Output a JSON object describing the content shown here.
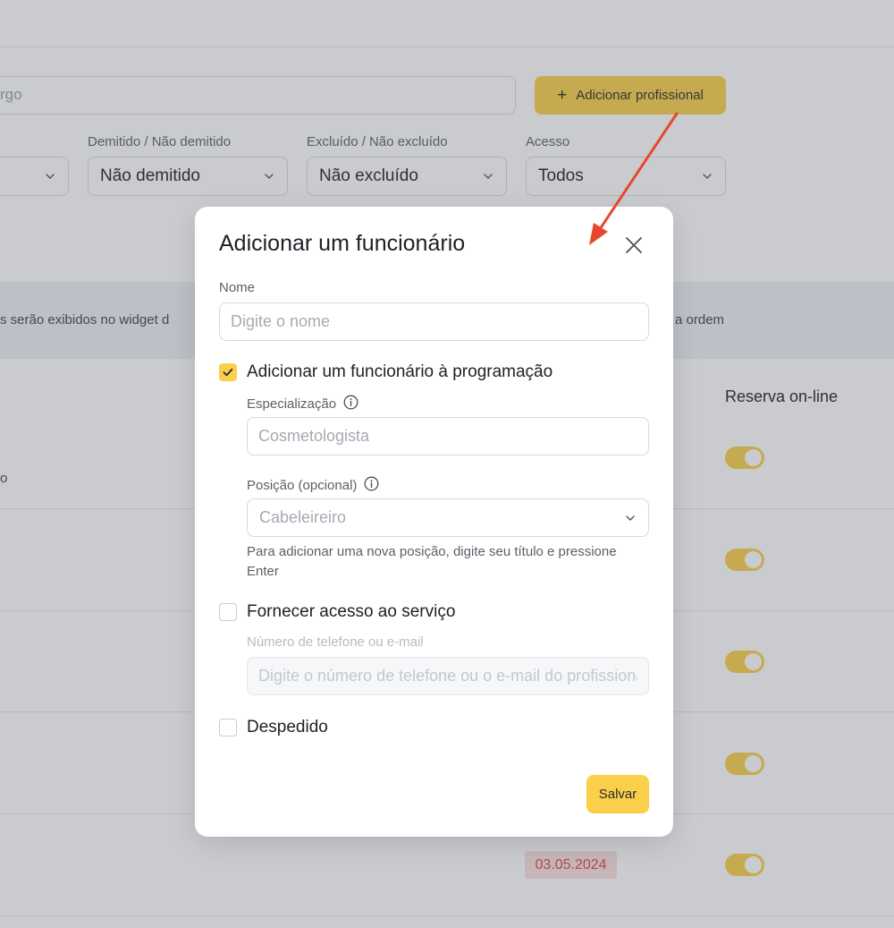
{
  "background": {
    "search_placeholder_fragment": "rgo",
    "add_button_label": "Adicionar profissional",
    "filters": [
      {
        "label": "",
        "value": ""
      },
      {
        "label": "Demitido / Não demitido",
        "value": "Não demitido"
      },
      {
        "label": "Excluído / Não excluído",
        "value": "Não excluído"
      },
      {
        "label": "Acesso",
        "value": "Todos"
      }
    ],
    "info_left": "s serão exibidos no widget d",
    "info_right": "a ordem",
    "column_header": "Reserva on-line",
    "stray_text": "o",
    "date_badge": "03.05.2024",
    "colors": {
      "accent": "#fad04a",
      "badge_bg": "#fbe1e1",
      "badge_text": "#d7474d",
      "arrow": "#e8472e"
    }
  },
  "modal": {
    "title": "Adicionar um funcionário",
    "name_label": "Nome",
    "name_placeholder": "Digite o nome",
    "schedule_checkbox": {
      "label": "Adicionar um funcionário à programação",
      "checked": true
    },
    "specialization_label": "Especialização",
    "specialization_placeholder": "Cosmetologista",
    "position_label": "Posição (opcional)",
    "position_placeholder": "Cabeleireiro",
    "position_hint": "Para adicionar uma nova posição, digite seu título e pressione Enter",
    "access_checkbox": {
      "label": "Fornecer acesso ao serviço",
      "checked": false
    },
    "contact_label": "Número de telefone ou e-mail",
    "contact_placeholder": "Digite o número de telefone ou o e-mail do profissional",
    "fired_checkbox": {
      "label": "Despedido",
      "checked": false
    },
    "save_label": "Salvar"
  }
}
